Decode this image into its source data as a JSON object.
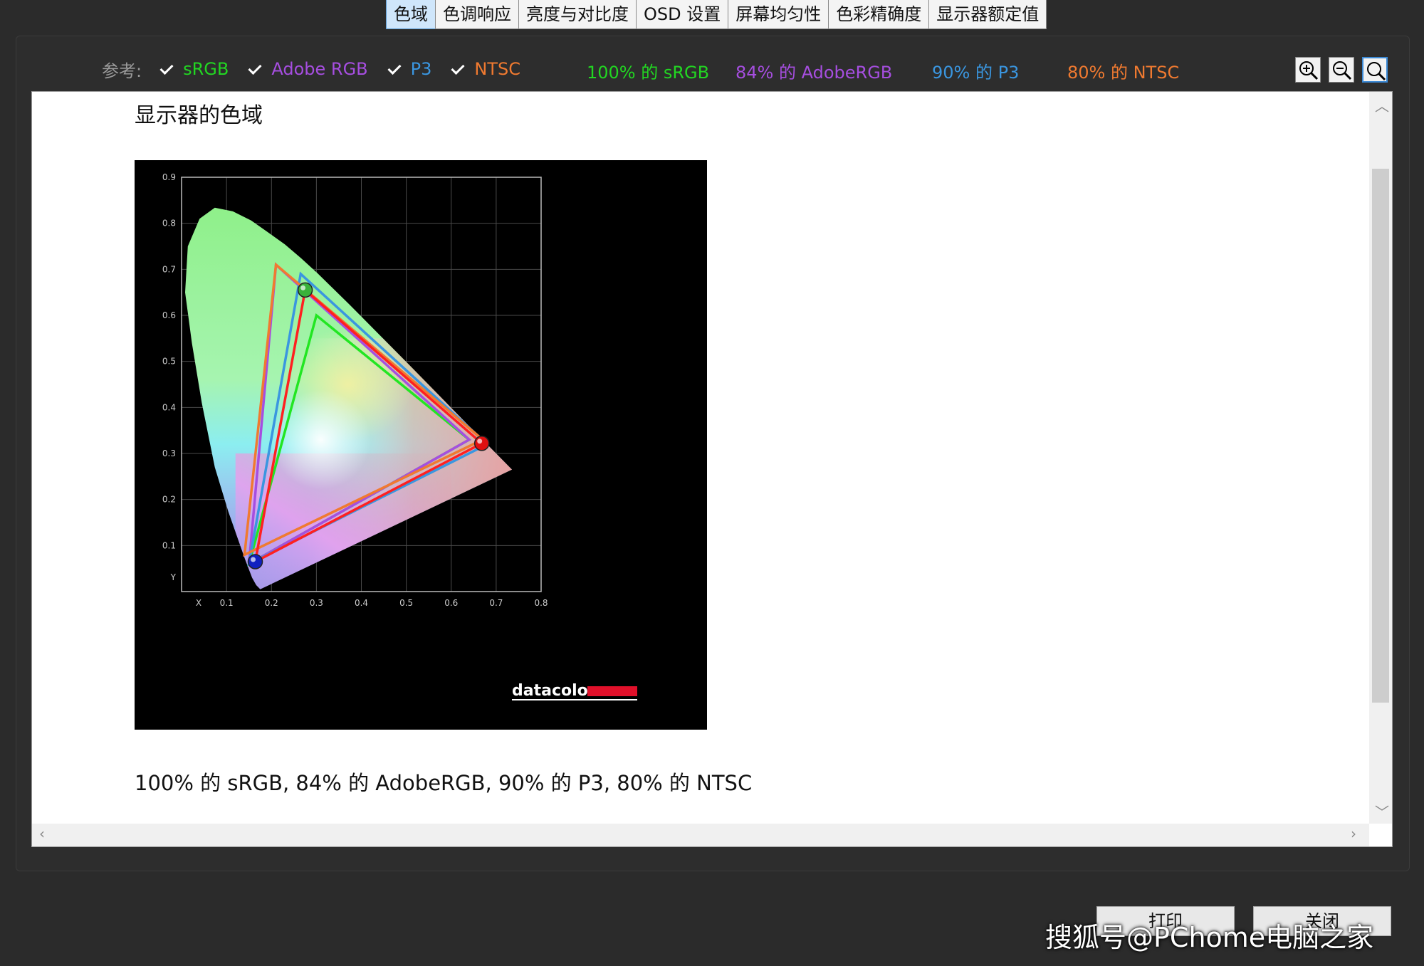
{
  "tabs": [
    {
      "label": "色域",
      "active": true
    },
    {
      "label": "色调响应",
      "active": false
    },
    {
      "label": "亮度与对比度",
      "active": false
    },
    {
      "label": "OSD 设置",
      "active": false
    },
    {
      "label": "屏幕均匀性",
      "active": false
    },
    {
      "label": "色彩精确度",
      "active": false
    },
    {
      "label": "显示器额定值",
      "active": false
    }
  ],
  "reference": {
    "label": "参考:",
    "items": [
      {
        "label": "sRGB",
        "checked": true,
        "color": "#22d622"
      },
      {
        "label": "Adobe RGB",
        "checked": true,
        "color": "#a64ee0"
      },
      {
        "label": "P3",
        "checked": true,
        "color": "#3a96e0"
      },
      {
        "label": "NTSC",
        "checked": true,
        "color": "#f07a30"
      }
    ]
  },
  "summary": [
    {
      "text": "100% 的 sRGB",
      "color": "#22d622"
    },
    {
      "text": "84% 的 AdobeRGB",
      "color": "#a64ee0"
    },
    {
      "text": "90% 的 P3",
      "color": "#3a96e0"
    },
    {
      "text": "80% 的 NTSC",
      "color": "#f07a30"
    }
  ],
  "zoom": [
    "zoom-in-icon",
    "zoom-out-icon",
    "zoom-fit-icon"
  ],
  "report": {
    "title": "显示器的色域",
    "caption": "100% 的 sRGB, 84% 的 AdobeRGB, 90% 的 P3, 80% 的 NTSC",
    "brand": "datacolor"
  },
  "buttons": {
    "print": "打印",
    "close": "关闭"
  },
  "watermark": "搜狐号@PChome电脑之家",
  "chart_data": {
    "type": "scatter",
    "title": "",
    "xlabel": "X",
    "ylabel": "Y",
    "xlim": [
      0,
      0.8
    ],
    "ylim": [
      0,
      0.9
    ],
    "xticks": [
      "0.1",
      "0.2",
      "0.3",
      "0.4",
      "0.5",
      "0.6",
      "0.7",
      "0.8"
    ],
    "yticks": [
      "0.1",
      "0.2",
      "0.3",
      "0.4",
      "0.5",
      "0.6",
      "0.7",
      "0.8",
      "0.9"
    ],
    "grid": true,
    "spectral_locus": [
      [
        0.175,
        0.005
      ],
      [
        0.166,
        0.014
      ],
      [
        0.157,
        0.03
      ],
      [
        0.141,
        0.071
      ],
      [
        0.104,
        0.174
      ],
      [
        0.074,
        0.27
      ],
      [
        0.045,
        0.41
      ],
      [
        0.023,
        0.54
      ],
      [
        0.008,
        0.65
      ],
      [
        0.014,
        0.75
      ],
      [
        0.04,
        0.81
      ],
      [
        0.074,
        0.834
      ],
      [
        0.114,
        0.826
      ],
      [
        0.155,
        0.806
      ],
      [
        0.193,
        0.78
      ],
      [
        0.23,
        0.754
      ],
      [
        0.266,
        0.724
      ],
      [
        0.302,
        0.692
      ],
      [
        0.373,
        0.624
      ],
      [
        0.444,
        0.554
      ],
      [
        0.512,
        0.487
      ],
      [
        0.575,
        0.424
      ],
      [
        0.627,
        0.372
      ],
      [
        0.735,
        0.265
      ]
    ],
    "series": [
      {
        "name": "sRGB",
        "color": "#22e622",
        "points": [
          [
            0.64,
            0.33
          ],
          [
            0.3,
            0.6
          ],
          [
            0.15,
            0.06
          ]
        ]
      },
      {
        "name": "Adobe RGB",
        "color": "#a64ee0",
        "points": [
          [
            0.64,
            0.33
          ],
          [
            0.21,
            0.71
          ],
          [
            0.15,
            0.06
          ]
        ]
      },
      {
        "name": "P3",
        "color": "#3a96e0",
        "points": [
          [
            0.68,
            0.32
          ],
          [
            0.265,
            0.69
          ],
          [
            0.15,
            0.06
          ]
        ]
      },
      {
        "name": "NTSC",
        "color": "#f07a30",
        "points": [
          [
            0.67,
            0.33
          ],
          [
            0.21,
            0.71
          ],
          [
            0.14,
            0.08
          ]
        ]
      },
      {
        "name": "",
        "color": "#ff2020",
        "points": [
          [
            0.668,
            0.322
          ],
          [
            0.275,
            0.655
          ],
          [
            0.164,
            0.065
          ]
        ]
      }
    ],
    "primaries": [
      {
        "x": 0.668,
        "y": 0.322,
        "color": "#e01010"
      },
      {
        "x": 0.275,
        "y": 0.655,
        "color": "#3ab23a"
      },
      {
        "x": 0.164,
        "y": 0.065,
        "color": "#1020c0"
      }
    ]
  }
}
